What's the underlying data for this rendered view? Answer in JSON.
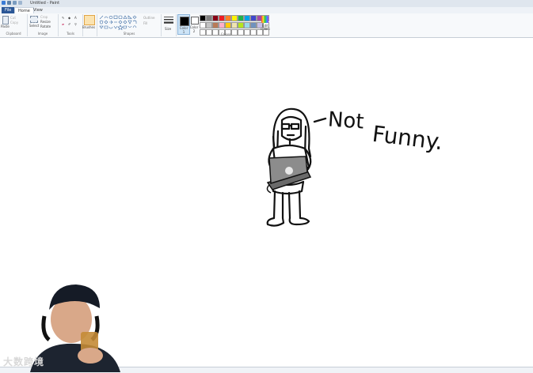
{
  "window": {
    "title": "Untitled - Paint"
  },
  "tabs": [
    {
      "label": "File"
    },
    {
      "label": "Home"
    },
    {
      "label": "View"
    }
  ],
  "ribbon": {
    "clipboard": {
      "label": "Clipboard",
      "paste": "Paste",
      "cut": "Cut",
      "copy": "Copy"
    },
    "image": {
      "label": "Image",
      "select": "Select",
      "crop": "Crop",
      "resize": "Resize",
      "rotate": "Rotate"
    },
    "tools": {
      "label": "Tools",
      "brushes": "Brushes"
    },
    "shapes": {
      "label": "Shapes",
      "outline": "Outline",
      "fill": "Fill"
    },
    "size": {
      "label": "Size"
    },
    "colors": {
      "label": "Colors",
      "color1": "Color 1",
      "color2": "Color 2",
      "edit_colors": "Edit colors"
    }
  },
  "palette": [
    "#000000",
    "#7f7f7f",
    "#880015",
    "#ed1c24",
    "#ff7f27",
    "#fff200",
    "#22b14c",
    "#00a2e8",
    "#3f48cc",
    "#a349a4",
    "#ffffff",
    "#ffffff",
    "#c3c3c3",
    "#b97a57",
    "#ffaec9",
    "#ffc90e",
    "#efe4b0",
    "#b5e61d",
    "#99d9ea",
    "#7092be",
    "#c8bfe7",
    "#ffffff",
    "#ffffff",
    "#ffffff",
    "#ffffff",
    "#ffffff",
    "#ffffff",
    "#ffffff",
    "#ffffff",
    "#ffffff",
    "#ffffff",
    "#ffffff",
    "#ffffff"
  ],
  "drawing": {
    "caption_dash": "-",
    "caption1": "Not",
    "caption2": "Funny."
  },
  "watermark": "大数跨境",
  "colors": {
    "accent": "#2b5797",
    "ribbon_bg": "#f7f9fb"
  }
}
